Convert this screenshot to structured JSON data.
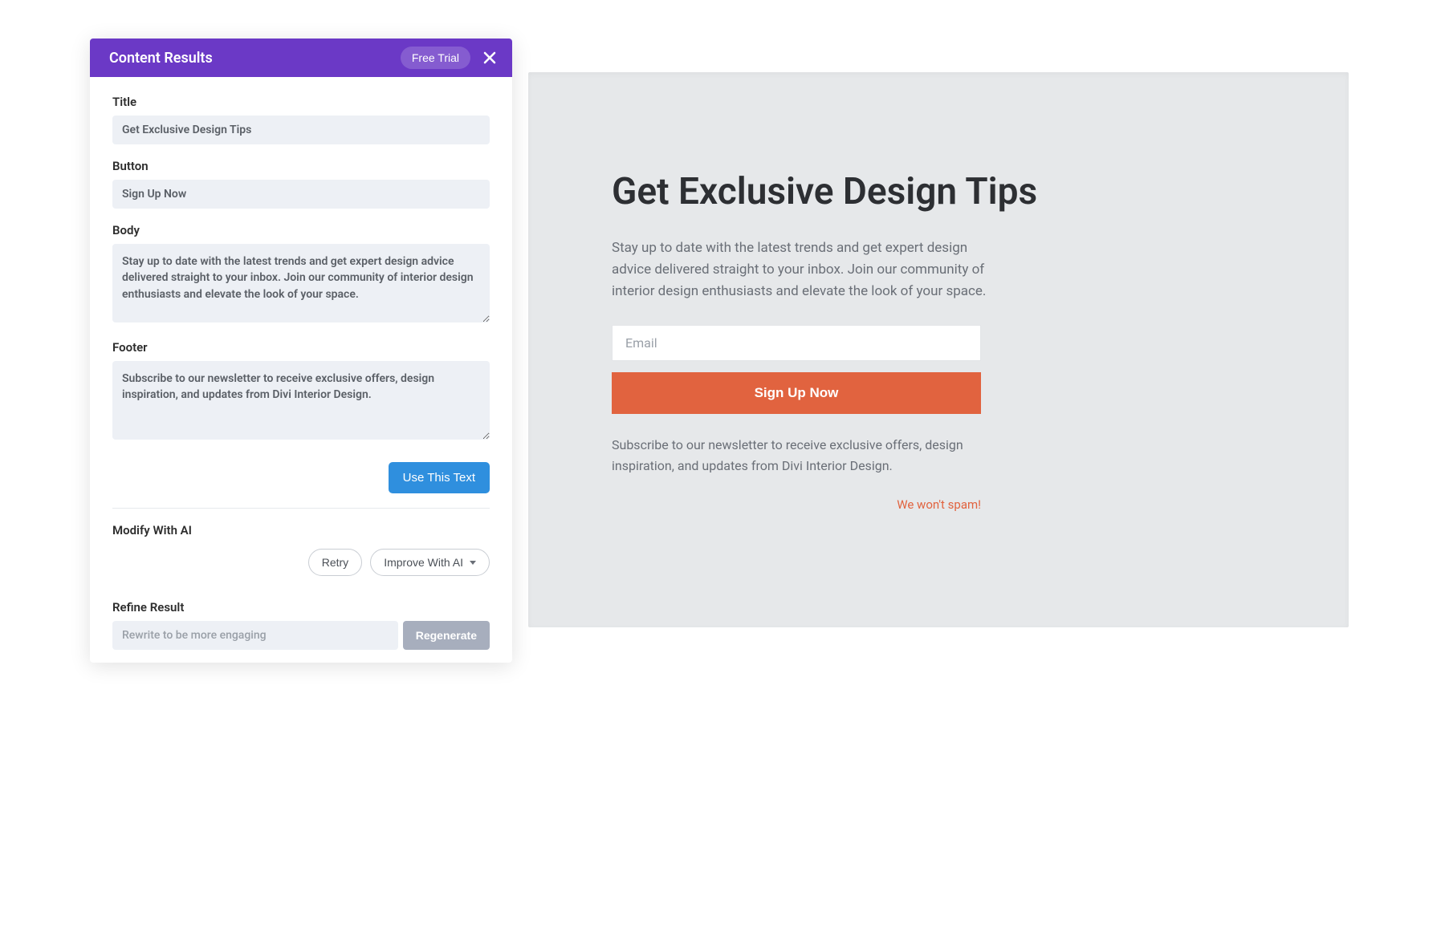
{
  "panel": {
    "header": {
      "title": "Content Results",
      "freeTrial": "Free Trial"
    },
    "fields": {
      "titleLabel": "Title",
      "titleValue": "Get Exclusive Design Tips",
      "buttonLabel": "Button",
      "buttonValue": "Sign Up Now",
      "bodyLabel": "Body",
      "bodyValue": "Stay up to date with the latest trends and get expert design advice delivered straight to your inbox. Join our community of interior design enthusiasts and elevate the look of your space.",
      "footerLabel": "Footer",
      "footerValue": "Subscribe to our newsletter to receive exclusive offers, design inspiration, and updates from Divi Interior Design."
    },
    "actions": {
      "useText": "Use This Text",
      "modifyLabel": "Modify With AI",
      "retry": "Retry",
      "improve": "Improve With AI",
      "refineLabel": "Refine Result",
      "refinePlaceholder": "Rewrite to be more engaging",
      "regenerate": "Regenerate"
    }
  },
  "preview": {
    "title": "Get Exclusive Design Tips",
    "body": "Stay up to date with the latest trends and get expert design advice delivered straight to your inbox. Join our community of interior design enthusiasts and elevate the look of your space.",
    "emailPlaceholder": "Email",
    "signup": "Sign Up Now",
    "footer": "Subscribe to our newsletter to receive exclusive offers, design inspiration, and updates from Divi Interior Design.",
    "spamNote": "We won't spam!"
  }
}
